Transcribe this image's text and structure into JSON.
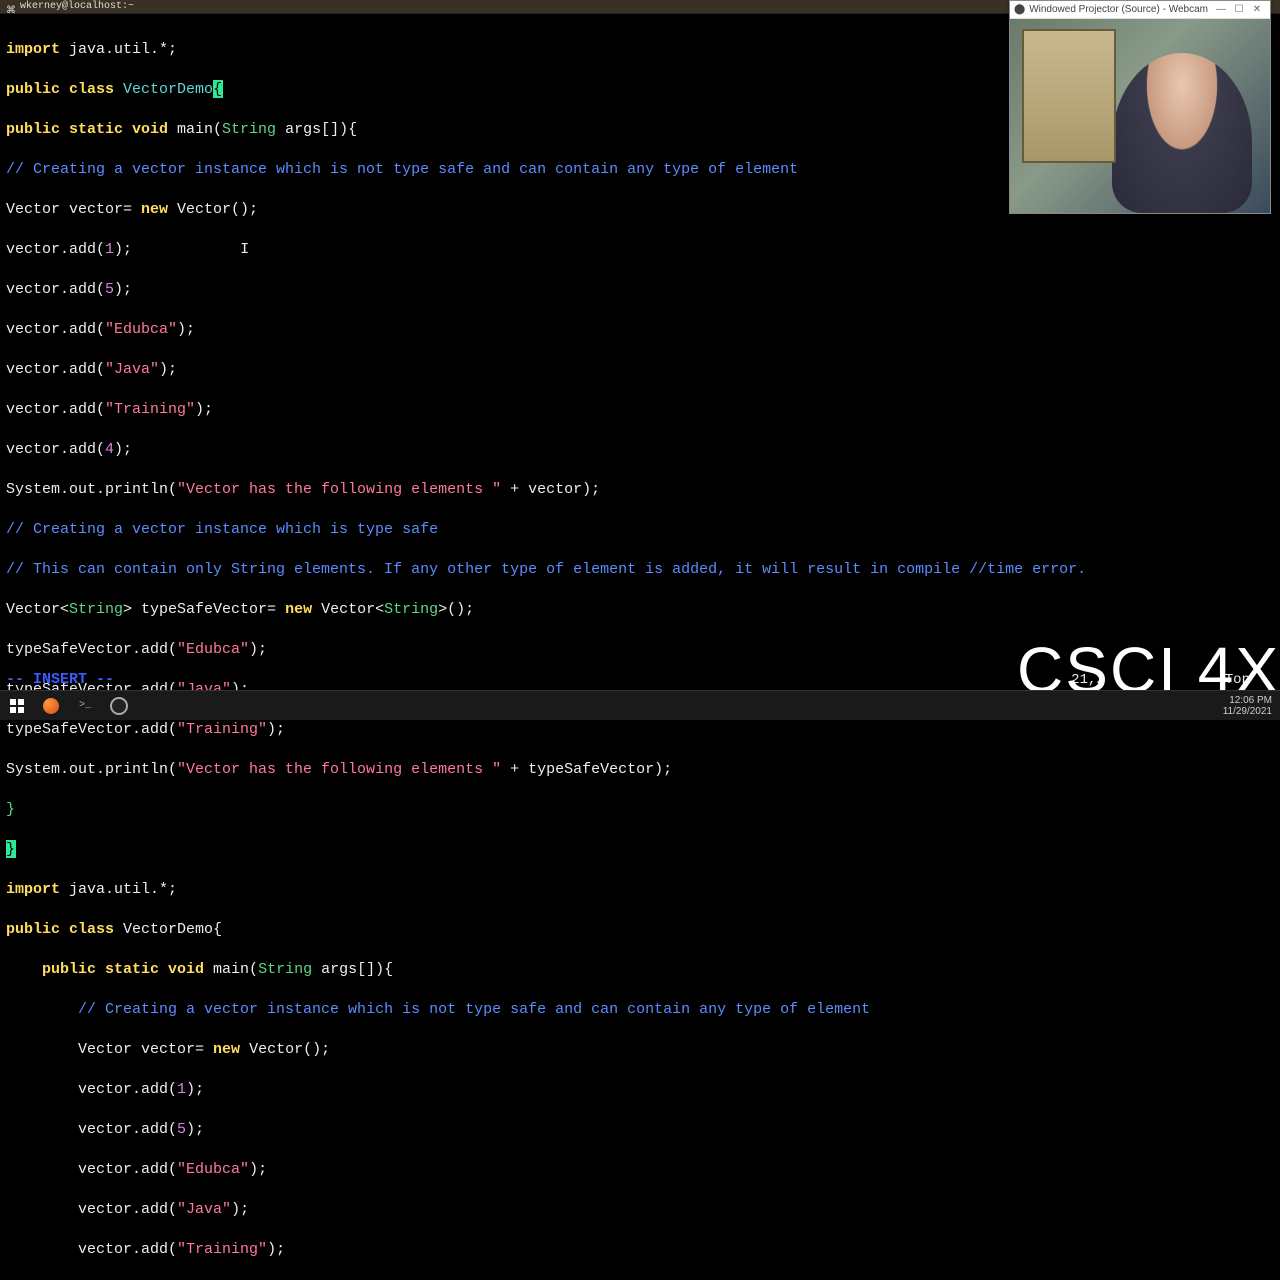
{
  "titlebar": {
    "text": "wkerney@localhost:~"
  },
  "webcam": {
    "title": "Windowed Projector (Source) - Webcam",
    "min": "—",
    "max": "☐",
    "close": "✕"
  },
  "course_label": "CSCI 4X",
  "status": {
    "mode": "-- INSERT --",
    "pos": "21,2",
    "scroll": "Top"
  },
  "tray": {
    "time": "12:06 PM",
    "date": "11/29/2021"
  },
  "code": {
    "l1": {
      "a": "import",
      "b": " java.util.*;"
    },
    "l2": {
      "a": "public class",
      "b": " VectorDemo",
      "c": "{"
    },
    "l3": {
      "a": "public static void",
      "b": " main(",
      "c": "String",
      "d": " args[]){"
    },
    "l4": "// Creating a vector instance which is not type safe and can contain any type of element",
    "l5": {
      "a": "Vector vector= ",
      "b": "new",
      "c": " Vector();"
    },
    "l6": {
      "a": "vector.add(",
      "n": "1",
      "b": ");"
    },
    "l6b": "            I",
    "l7": {
      "a": "vector.add(",
      "n": "5",
      "b": ");"
    },
    "l8": {
      "a": "vector.add(",
      "s": "\"Edubca\"",
      "b": ");"
    },
    "l9": {
      "a": "vector.add(",
      "s": "\"Java\"",
      "b": ");"
    },
    "l10": {
      "a": "vector.add(",
      "s": "\"Training\"",
      "b": ");"
    },
    "l11": {
      "a": "vector.add(",
      "n": "4",
      "b": ");"
    },
    "l12": {
      "a": "System.out.println(",
      "s": "\"Vector has the following elements \"",
      "b": " + vector);"
    },
    "l13": "// Creating a vector instance which is type safe",
    "l14": "// This can contain only String elements. If any other type of element is added, it will result in compile //time error.",
    "l15": {
      "a": "Vector<",
      "b": "String",
      "c": "> typeSafeVector= ",
      "d": "new",
      "e": " Vector<",
      "f": "String",
      "g": ">();"
    },
    "l16": {
      "a": "typeSafeVector.add(",
      "s": "\"Edubca\"",
      "b": ");"
    },
    "l17": {
      "a": "typeSafeVector.add(",
      "s": "\"Java\"",
      "b": ");"
    },
    "l18": {
      "a": "typeSafeVector.add(",
      "s": "\"Training\"",
      "b": ");"
    },
    "l19": {
      "a": "System.out.println(",
      "s": "\"Vector has the following elements \"",
      "b": " + typeSafeVector);"
    },
    "l20": "}",
    "l21": "}",
    "l22": {
      "a": "import",
      "b": " java.util.*;"
    },
    "l23": {
      "a": "public class",
      "b": " VectorDemo{"
    },
    "l24": {
      "i": "    ",
      "a": "public static void",
      "b": " main(",
      "c": "String",
      "d": " args[]){"
    },
    "l25": {
      "i": "        ",
      "c": "// Creating a vector instance which is not type safe and can contain any type of element"
    },
    "l26": {
      "i": "        ",
      "a": "Vector vector= ",
      "b": "new",
      "c": " Vector();"
    },
    "l27": {
      "i": "        ",
      "a": "vector.add(",
      "n": "1",
      "b": ");"
    },
    "l28": {
      "i": "        ",
      "a": "vector.add(",
      "n": "5",
      "b": ");"
    },
    "l29": {
      "i": "        ",
      "a": "vector.add(",
      "s": "\"Edubca\"",
      "b": ");"
    },
    "l30": {
      "i": "        ",
      "a": "vector.add(",
      "s": "\"Java\"",
      "b": ");"
    },
    "l31": {
      "i": "        ",
      "a": "vector.add(",
      "s": "\"Training\"",
      "b": ");"
    }
  }
}
